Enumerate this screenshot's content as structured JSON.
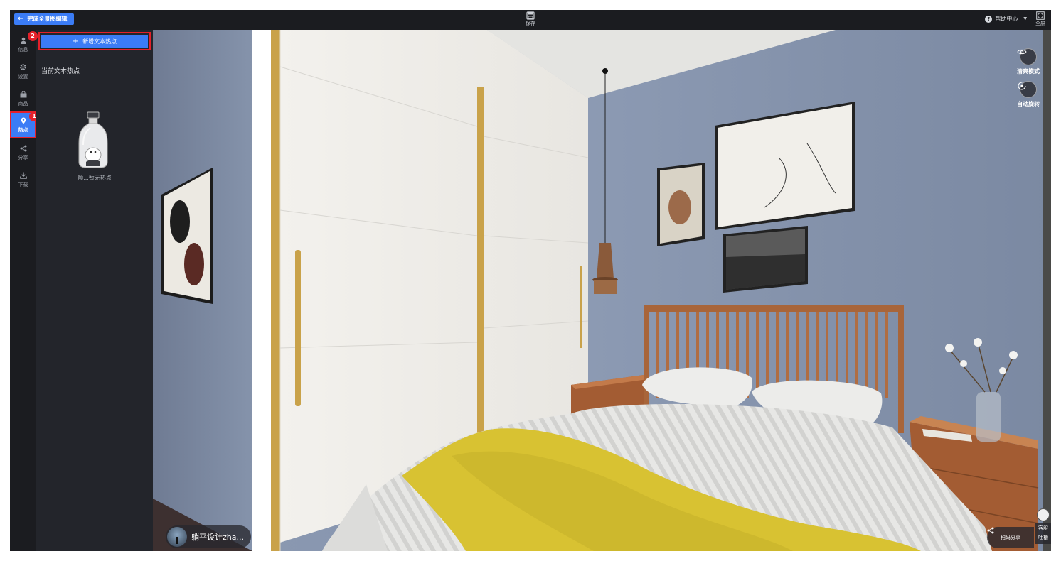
{
  "topbar": {
    "back_label": "完成全景图编辑",
    "save_label": "保存",
    "help_label": "帮助中心",
    "fullscreen_label": "全屏"
  },
  "sidebar": {
    "items": [
      {
        "label": "信息",
        "icon": "user-icon"
      },
      {
        "label": "设置",
        "icon": "gear-icon"
      },
      {
        "label": "商品",
        "icon": "bag-icon"
      },
      {
        "label": "热点",
        "icon": "location-pin-icon",
        "active": true
      },
      {
        "label": "分享",
        "icon": "share-icon"
      },
      {
        "label": "下载",
        "icon": "download-icon"
      }
    ]
  },
  "badges": {
    "first": "1",
    "second": "2"
  },
  "panel": {
    "add_button_label": "新增文本热点",
    "section_title": "当前文本热点",
    "empty_text": "额...暂无热点"
  },
  "scene_controls": {
    "clear_mode_label": "清爽模式",
    "auto_rotate_label": "自动旋转",
    "author_name": "躺平设计zha...",
    "share_label": "扫码分享",
    "service_label_1": "客服",
    "service_label_2": "吐槽"
  },
  "colors": {
    "accent": "#3b7cf6",
    "highlight": "#e5202a",
    "dark_bg": "#1b1c20",
    "panel_bg": "#23252b"
  }
}
